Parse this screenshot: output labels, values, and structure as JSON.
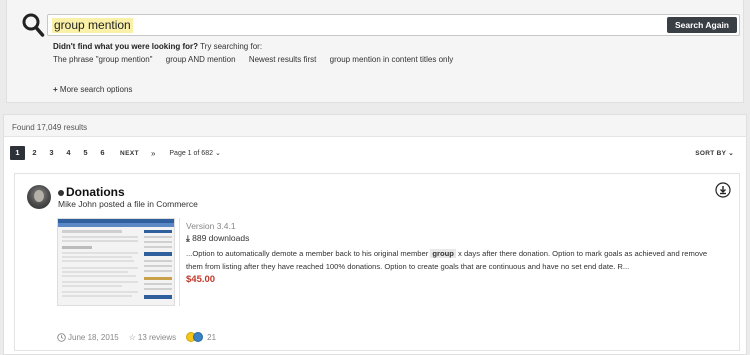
{
  "search": {
    "query": "group mention",
    "button_label": "Search Again",
    "didnt_find_bold": "Didn't find what you were looking for?",
    "didnt_find_rest": " Try searching for:",
    "suggestions": [
      "The phrase \"group mention\"",
      "group AND mention",
      "Newest results first",
      "group mention in content titles only"
    ],
    "more_options": "More search options"
  },
  "results": {
    "count_text": "Found 17,049 results",
    "pages": [
      "1",
      "2",
      "3",
      "4",
      "5",
      "6"
    ],
    "next_label": "NEXT",
    "last_label": "»",
    "page_of": "Page 1 of 682",
    "sort_label": "SORT BY"
  },
  "item": {
    "title": "Donations",
    "byline": "Mike John posted a file in Commerce",
    "version": "Version 3.4.1",
    "downloads": "889 downloads",
    "snippet_before": "...Option to automatically demote a member back to his original member",
    "snippet_highlight": "group",
    "snippet_after": "x days after there donation. Option to mark goals as achieved and remove them from listing after they have reached 100% donations. Option to create goals that are continuous and have no set end date. R...",
    "price": "$45.00",
    "date": "June 18, 2015",
    "reviews": "13 reviews",
    "reaction_count": "21"
  },
  "colors": {
    "button_bg": "#3a3f46",
    "highlight_query": "#fbf0a8",
    "price": "#c0392b",
    "active_page": "#2d3238"
  },
  "icons": [
    "search-icon",
    "plus-icon",
    "chevron-down-icon",
    "download-icon",
    "clock-icon",
    "star-icon",
    "reaction-icon"
  ]
}
